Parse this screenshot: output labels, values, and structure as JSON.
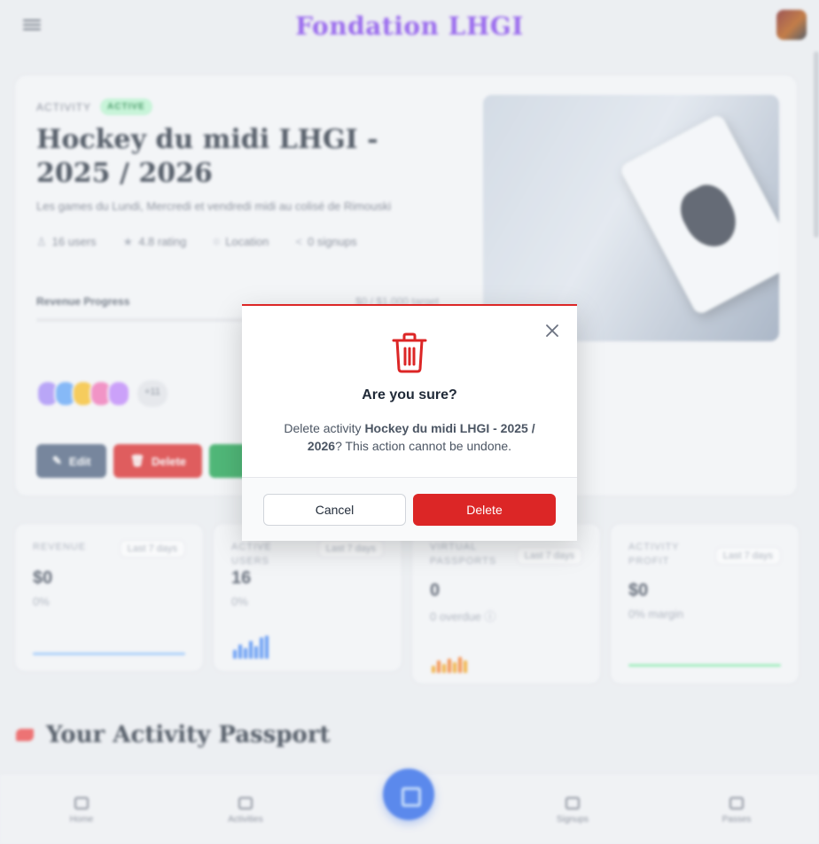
{
  "brand": {
    "title": "Fondation LHGI",
    "color": "#7c3aed"
  },
  "activity": {
    "eyebrow": "ACTIVITY",
    "status": "ACTIVE",
    "title": "Hockey du midi LHGI - 2025 / 2026",
    "description": "Les games du Lundi, Mercredi et vendredi midi au colisé de Rimouski",
    "stats": {
      "users": "16 users",
      "rating": "4.8 rating",
      "location": "Location",
      "signups": "0 signups"
    },
    "revenue_label": "Revenue Progress",
    "revenue_target": "$0 / $1,000 target",
    "revenue_progress": 0,
    "more_participants": "+11",
    "buttons": {
      "edit": "Edit",
      "delete": "Delete"
    }
  },
  "metrics": [
    {
      "label": "REVENUE",
      "period": "Last 7 days",
      "value": "$0",
      "sub": "0%"
    },
    {
      "label": "ACTIVE USERS",
      "period": "Last 7 days",
      "value": "16",
      "sub": "0%"
    },
    {
      "label": "VIRTUAL PASSPORTS",
      "period": "Last 7 days",
      "value": "0",
      "sub": "0 overdue ⓘ"
    },
    {
      "label": "ACTIVITY PROFIT",
      "period": "Last 7 days",
      "value": "$0",
      "sub": "0% margin"
    }
  ],
  "passport": {
    "title": "Your Activity Passport"
  },
  "bottom_nav": {
    "home": "Home",
    "activities": "Activities",
    "signups": "Signups",
    "passes": "Passes"
  },
  "modal": {
    "title": "Are you sure?",
    "message_prefix": "Delete activity ",
    "message_activity": "Hockey du midi LHGI - 2025 / 2026",
    "message_suffix": "? This action cannot be undone.",
    "cancel_label": "Cancel",
    "delete_label": "Delete",
    "accent_color": "#dc2626",
    "icon": "trash-icon"
  }
}
